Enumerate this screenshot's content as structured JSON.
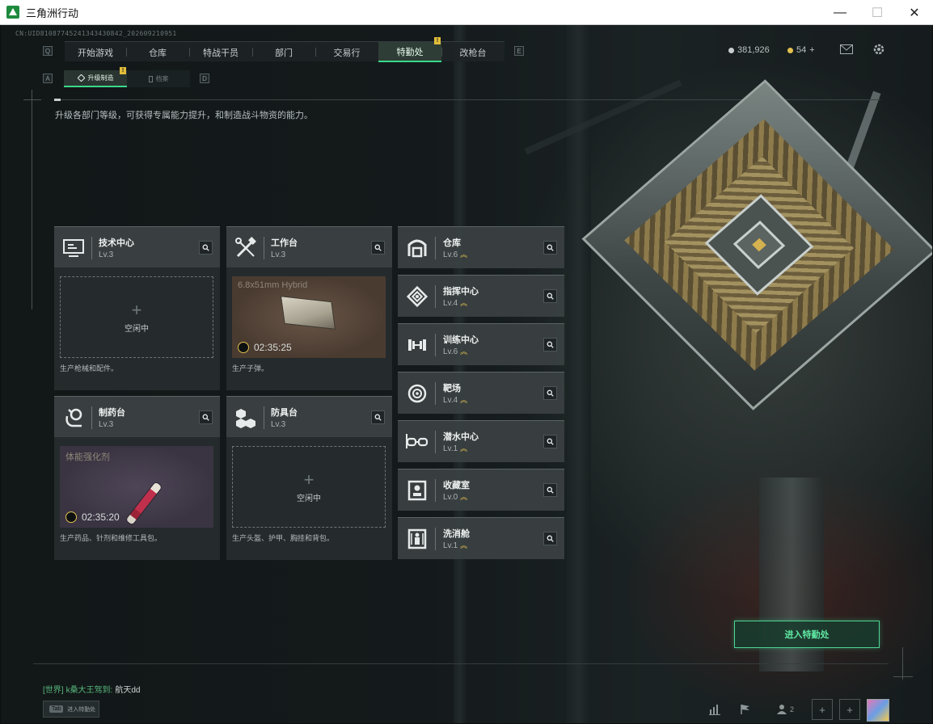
{
  "window": {
    "title": "三角洲行动",
    "controls": {
      "minimize": "—",
      "maximize": "☐",
      "close": "✕"
    }
  },
  "uid": "CN:UID8108774524134343084​2_2026092​10951",
  "main_tabs": [
    {
      "label": "开始游戏",
      "active": false
    },
    {
      "label": "仓库",
      "active": false
    },
    {
      "label": "特战干员",
      "active": false
    },
    {
      "label": "部门",
      "active": false
    },
    {
      "label": "交易行",
      "active": false
    },
    {
      "label": "特勤处",
      "active": true,
      "badge": "!"
    },
    {
      "label": "改枪台",
      "active": false
    }
  ],
  "nav_keys": {
    "left": "Q",
    "right": "E",
    "sub_left": "A",
    "sub_right": "D"
  },
  "currency": {
    "coins": "381,926",
    "gems": "54",
    "gems_add": "+"
  },
  "sub_tabs": [
    {
      "label": "升级制造",
      "active": true,
      "badge": "!"
    },
    {
      "label": "档案",
      "active": false
    }
  ],
  "description": "升级各部门等级，可获得专属能力提升，和制造战斗物资的能力。",
  "production_cards": [
    {
      "name": "技术中心",
      "level": "Lv.3",
      "icon": "computer-icon",
      "status": "empty",
      "empty_text": "空闲中",
      "plus": "+",
      "footer": "生产枪械和配件。"
    },
    {
      "name": "工作台",
      "level": "Lv.3",
      "icon": "tools-icon",
      "status": "producing",
      "item_name": "6.8x51mm Hybrid",
      "timer": "02:35:25",
      "footer": "生产子弹。"
    },
    {
      "name": "制药台",
      "level": "Lv.3",
      "icon": "microscope-icon",
      "status": "producing",
      "item_name": "体能强化剂",
      "timer": "02:35:20",
      "footer": "生产药品、针剂和维修工具包。"
    },
    {
      "name": "防具台",
      "level": "Lv.3",
      "icon": "armor-blocks-icon",
      "status": "empty",
      "empty_text": "空闲中",
      "plus": "+",
      "footer": "生产头盔、护甲、胸挂和背包。"
    }
  ],
  "departments": [
    {
      "name": "仓库",
      "level": "Lv.6",
      "icon": "warehouse-icon",
      "upgradable": true
    },
    {
      "name": "指挥中心",
      "level": "Lv.4",
      "icon": "command-icon",
      "upgradable": true
    },
    {
      "name": "训练中心",
      "level": "Lv.6",
      "icon": "dumbbell-icon",
      "upgradable": true
    },
    {
      "name": "靶场",
      "level": "Lv.4",
      "icon": "target-icon",
      "upgradable": true
    },
    {
      "name": "潜水中心",
      "level": "Lv.1",
      "icon": "goggles-icon",
      "upgradable": true
    },
    {
      "name": "收藏室",
      "level": "Lv.0",
      "icon": "collection-icon",
      "upgradable": true
    },
    {
      "name": "洗消舱",
      "level": "Lv.1",
      "icon": "decon-icon",
      "upgradable": true
    }
  ],
  "enter_button": "进入特勤处",
  "chat": {
    "channel": "[世界]",
    "sender": "k桑大王驾到:",
    "message": "航天dd"
  },
  "tab_hint": {
    "key": "Tab",
    "label": "进入特勤处"
  },
  "bottom": {
    "friends_count": "2"
  },
  "colors": {
    "accent": "#39d98a",
    "badge": "#e1bd3a",
    "enter_button": "#4fd695"
  }
}
